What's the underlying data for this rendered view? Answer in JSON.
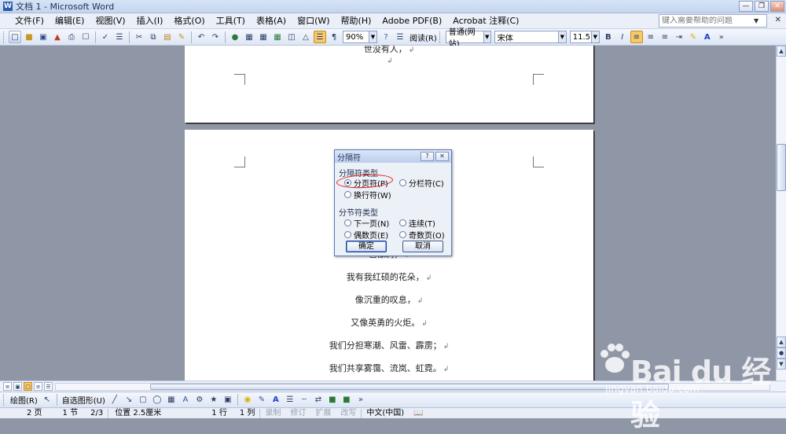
{
  "window": {
    "title": "文档 1 - Microsoft Word"
  },
  "menu": {
    "items": [
      "文件(F)",
      "编辑(E)",
      "视图(V)",
      "插入(I)",
      "格式(O)",
      "工具(T)",
      "表格(A)",
      "窗口(W)",
      "帮助(H)",
      "Adobe PDF(B)",
      "Acrobat 注释(C)"
    ],
    "help_placeholder": "键入需要帮助的问题"
  },
  "toolbar": {
    "zoom": "90%",
    "read_label": "阅读(R)",
    "style": "普通(网站)",
    "font": "宋体",
    "size": "11.5",
    "bold": "B",
    "italic": "I"
  },
  "document": {
    "page1_lines": [
      "世没有人，"
    ],
    "page2_lines": [
      "也像刺，",
      "我有我红硕的花朵，",
      "像沉重的叹息，",
      "又像英勇的火炬。",
      "我们分担寒潮、风雷、霹雳；",
      "我们共享雾霭、流岚、虹霓。"
    ]
  },
  "dialog": {
    "title": "分隔符",
    "group_break": "分隔符类型",
    "page_break": "分页符(P)",
    "column_break": "分栏符(C)",
    "text_wrap": "换行符(W)",
    "group_section": "分节符类型",
    "next_page": "下一页(N)",
    "continuous": "连续(T)",
    "even_page": "偶数页(E)",
    "odd_page": "奇数页(O)",
    "ok": "确定",
    "cancel": "取消",
    "selected": "page_break"
  },
  "drawbar": {
    "draw_label": "绘图(R)",
    "autoshape_label": "自选图形(U)"
  },
  "status": {
    "page": "2 页",
    "section": "1 节",
    "pages": "2/3",
    "position": "位置 2.5厘米",
    "line": "1 行",
    "column": "1 列",
    "rec": "录制",
    "trk": "修订",
    "ext": "扩展",
    "ovr": "改写",
    "language": "中文(中国)"
  },
  "watermark": {
    "brand": "Bai du 经验",
    "url": "jingyan.baidu.com"
  },
  "colors": {
    "accent": "#f7c96b",
    "annotation": "#e01818"
  }
}
